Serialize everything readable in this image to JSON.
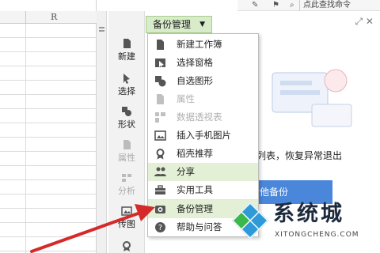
{
  "grid": {
    "column_letter": "R"
  },
  "topbar": {
    "search_placeholder": "点此查找命令"
  },
  "toolbar": {
    "items": [
      {
        "label": "新建",
        "icon": "new-icon",
        "enabled": true
      },
      {
        "label": "选择",
        "icon": "select-cursor-icon",
        "enabled": true
      },
      {
        "label": "形状",
        "icon": "shape-icon",
        "enabled": true
      },
      {
        "label": "属性",
        "icon": "properties-icon",
        "enabled": false
      },
      {
        "label": "分析",
        "icon": "analysis-icon",
        "enabled": false
      },
      {
        "label": "传图",
        "icon": "upload-image-icon",
        "enabled": true
      }
    ]
  },
  "menu": {
    "trigger_label": "备份管理",
    "items": [
      {
        "label": "新建工作簿",
        "icon": "new-document-icon",
        "enabled": true
      },
      {
        "label": "选择窗格",
        "icon": "selection-pane-icon",
        "enabled": true
      },
      {
        "label": "自选图形",
        "icon": "shapes-icon",
        "enabled": true
      },
      {
        "label": "属性",
        "icon": "properties-icon",
        "enabled": false
      },
      {
        "label": "数据透视表",
        "icon": "pivot-table-icon",
        "enabled": false
      },
      {
        "label": "插入手机图片",
        "icon": "phone-image-icon",
        "enabled": true
      },
      {
        "label": "稻壳推荐",
        "icon": "recommend-icon",
        "enabled": true
      },
      {
        "label": "分享",
        "icon": "share-people-icon",
        "enabled": true
      },
      {
        "label": "实用工具",
        "icon": "toolbox-icon",
        "enabled": true
      },
      {
        "label": "备份管理",
        "icon": "backup-icon",
        "enabled": true
      },
      {
        "label": "帮助与问答",
        "icon": "help-icon",
        "enabled": true
      }
    ]
  },
  "panel": {
    "text_fragment": "列表，恢复异常退出",
    "other_backup_label": "他备份"
  },
  "watermark": {
    "title": "系统城",
    "subtitle": "XITONGCHENG.COM"
  },
  "colors": {
    "menu_highlight": "#e3f0d6",
    "trigger_bg": "#d8ecc9",
    "accent_blue": "#4a86d9",
    "arrow_red": "#d42a2a"
  }
}
